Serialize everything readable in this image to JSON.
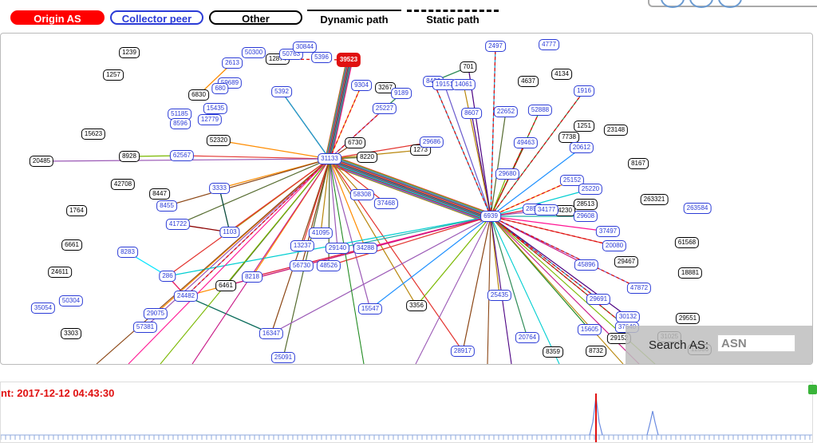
{
  "legend": {
    "origin_label": "Origin AS",
    "peer_label": "Collector peer",
    "other_label": "Other",
    "dynamic_label": "Dynamic path",
    "static_label": "Static path"
  },
  "search": {
    "label": "Search AS:",
    "placeholder": "ASN"
  },
  "timeline": {
    "label": "nt: 2017-12-12 04:43:30"
  },
  "colors": {
    "origin": "#e01010",
    "peer": "#2b3bd6",
    "other": "#000000"
  },
  "graph": {
    "nodes": [
      {
        "id": "39523",
        "type": "origin"
      },
      {
        "id": "1239",
        "type": "other"
      },
      {
        "id": "1257",
        "type": "other"
      },
      {
        "id": "6830",
        "type": "other"
      },
      {
        "id": "15623",
        "type": "other"
      },
      {
        "id": "8928",
        "type": "other"
      },
      {
        "id": "20485",
        "type": "other"
      },
      {
        "id": "42708",
        "type": "other"
      },
      {
        "id": "8447",
        "type": "other"
      },
      {
        "id": "1764",
        "type": "other"
      },
      {
        "id": "6661",
        "type": "other"
      },
      {
        "id": "24611",
        "type": "other"
      },
      {
        "id": "3303",
        "type": "other"
      },
      {
        "id": "52320",
        "type": "other"
      },
      {
        "id": "6461",
        "type": "other"
      },
      {
        "id": "3356",
        "type": "other"
      },
      {
        "id": "12874",
        "type": "other"
      },
      {
        "id": "3267",
        "type": "other"
      },
      {
        "id": "6730",
        "type": "other"
      },
      {
        "id": "8220",
        "type": "other"
      },
      {
        "id": "1273",
        "type": "other"
      },
      {
        "id": "701",
        "type": "other"
      },
      {
        "id": "4637",
        "type": "other"
      },
      {
        "id": "4134",
        "type": "other"
      },
      {
        "id": "1251",
        "type": "other"
      },
      {
        "id": "7738",
        "type": "other"
      },
      {
        "id": "23148",
        "type": "other"
      },
      {
        "id": "8167",
        "type": "other"
      },
      {
        "id": "263321",
        "type": "other"
      },
      {
        "id": "28513",
        "type": "other"
      },
      {
        "id": "4230",
        "type": "other"
      },
      {
        "id": "61568",
        "type": "other"
      },
      {
        "id": "29467",
        "type": "other"
      },
      {
        "id": "18881",
        "type": "other"
      },
      {
        "id": "29551",
        "type": "other"
      },
      {
        "id": "29152",
        "type": "other"
      },
      {
        "id": "31025",
        "type": "other"
      },
      {
        "id": "12586",
        "type": "other"
      },
      {
        "id": "8359",
        "type": "other"
      },
      {
        "id": "8732",
        "type": "other"
      },
      {
        "id": "2613",
        "type": "peer"
      },
      {
        "id": "50300",
        "type": "peer"
      },
      {
        "id": "50763",
        "type": "peer"
      },
      {
        "id": "30844",
        "type": "peer"
      },
      {
        "id": "5396",
        "type": "peer"
      },
      {
        "id": "59689",
        "type": "peer"
      },
      {
        "id": "680",
        "type": "peer"
      },
      {
        "id": "5392",
        "type": "peer"
      },
      {
        "id": "15435",
        "type": "peer"
      },
      {
        "id": "51185",
        "type": "peer"
      },
      {
        "id": "8596",
        "type": "peer"
      },
      {
        "id": "12779",
        "type": "peer"
      },
      {
        "id": "62567",
        "type": "peer"
      },
      {
        "id": "31133",
        "type": "peer"
      },
      {
        "id": "3333",
        "type": "peer"
      },
      {
        "id": "8455",
        "type": "peer"
      },
      {
        "id": "41722",
        "type": "peer"
      },
      {
        "id": "1103",
        "type": "peer"
      },
      {
        "id": "8283",
        "type": "peer"
      },
      {
        "id": "286",
        "type": "peer"
      },
      {
        "id": "24482",
        "type": "peer"
      },
      {
        "id": "8218",
        "type": "peer"
      },
      {
        "id": "50304",
        "type": "peer"
      },
      {
        "id": "35054",
        "type": "peer"
      },
      {
        "id": "29075",
        "type": "peer"
      },
      {
        "id": "57381",
        "type": "peer"
      },
      {
        "id": "16347",
        "type": "peer"
      },
      {
        "id": "25091",
        "type": "peer"
      },
      {
        "id": "9304",
        "type": "peer"
      },
      {
        "id": "9189",
        "type": "peer"
      },
      {
        "id": "25227",
        "type": "peer"
      },
      {
        "id": "58308",
        "type": "peer"
      },
      {
        "id": "37468",
        "type": "peer"
      },
      {
        "id": "41095",
        "type": "peer"
      },
      {
        "id": "13237",
        "type": "peer"
      },
      {
        "id": "29140",
        "type": "peer"
      },
      {
        "id": "34288",
        "type": "peer"
      },
      {
        "id": "56730",
        "type": "peer"
      },
      {
        "id": "48526",
        "type": "peer"
      },
      {
        "id": "15547",
        "type": "peer"
      },
      {
        "id": "29686",
        "type": "peer"
      },
      {
        "id": "2497",
        "type": "peer"
      },
      {
        "id": "4777",
        "type": "peer"
      },
      {
        "id": "8426",
        "type": "peer"
      },
      {
        "id": "19151",
        "type": "peer"
      },
      {
        "id": "14061",
        "type": "peer"
      },
      {
        "id": "8607",
        "type": "peer"
      },
      {
        "id": "22652",
        "type": "peer"
      },
      {
        "id": "52888",
        "type": "peer"
      },
      {
        "id": "1916",
        "type": "peer"
      },
      {
        "id": "49463",
        "type": "peer"
      },
      {
        "id": "20612",
        "type": "peer"
      },
      {
        "id": "29680",
        "type": "peer"
      },
      {
        "id": "6939",
        "type": "peer"
      },
      {
        "id": "25152",
        "type": "peer"
      },
      {
        "id": "25220",
        "type": "peer"
      },
      {
        "id": "2856",
        "type": "peer"
      },
      {
        "id": "34177",
        "type": "peer"
      },
      {
        "id": "29608",
        "type": "peer"
      },
      {
        "id": "263584",
        "type": "peer"
      },
      {
        "id": "37497",
        "type": "peer"
      },
      {
        "id": "20080",
        "type": "peer"
      },
      {
        "id": "45896",
        "type": "peer"
      },
      {
        "id": "47872",
        "type": "peer"
      },
      {
        "id": "25435",
        "type": "peer"
      },
      {
        "id": "29691",
        "type": "peer"
      },
      {
        "id": "30132",
        "type": "peer"
      },
      {
        "id": "37640",
        "type": "peer"
      },
      {
        "id": "15605",
        "type": "peer"
      },
      {
        "id": "20764",
        "type": "peer"
      },
      {
        "id": "28917",
        "type": "peer"
      }
    ]
  }
}
